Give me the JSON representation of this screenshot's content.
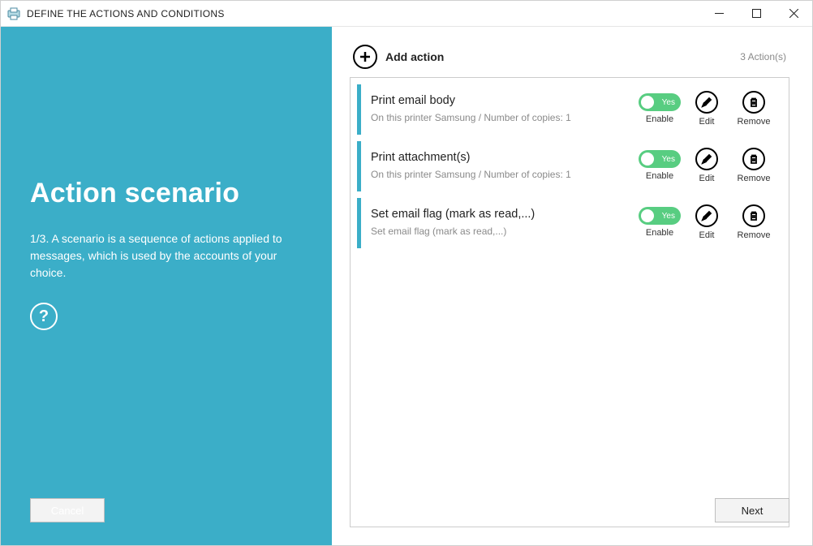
{
  "titlebar": {
    "title": "DEFINE THE ACTIONS AND CONDITIONS"
  },
  "sidebar": {
    "heading": "Action scenario",
    "description": "1/3. A scenario is a sequence of actions applied to messages, which is used by the accounts of your choice.",
    "cancel_label": "Cancel"
  },
  "main": {
    "add_label": "Add action",
    "count_label": "3  Action(s)",
    "toggle_text": "Yes",
    "labels": {
      "enable": "Enable",
      "edit": "Edit",
      "remove": "Remove"
    },
    "next_label": "Next",
    "actions": [
      {
        "title": "Print email body",
        "sub": "On this printer Samsung / Number of copies: 1"
      },
      {
        "title": "Print attachment(s)",
        "sub": "On this printer Samsung / Number of copies: 1"
      },
      {
        "title": "Set email flag (mark as read,...)",
        "sub": "Set email flag (mark as read,...)"
      }
    ]
  }
}
